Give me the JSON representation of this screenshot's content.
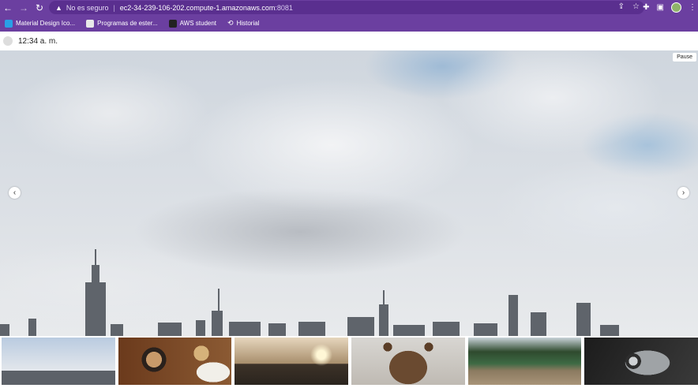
{
  "browser": {
    "security_label": "No es seguro",
    "host": "ec2-34-239-106-202.compute-1.amazonaws.com",
    "port": ":8081",
    "bookmarks": [
      {
        "label": "Material Design Ico..."
      },
      {
        "label": "Programas de ester..."
      },
      {
        "label": "AWS student"
      },
      {
        "label": "Historial"
      }
    ]
  },
  "clock": {
    "time": "12:34 a. m."
  },
  "carousel": {
    "pause_label": "Pause",
    "prev_icon": "chevron-left-icon",
    "next_icon": "chevron-right-icon"
  },
  "thumbnails": [
    {
      "name": "thumbnail-city-skyline"
    },
    {
      "name": "thumbnail-coffee-cup"
    },
    {
      "name": "thumbnail-sunset-valley"
    },
    {
      "name": "thumbnail-bear"
    },
    {
      "name": "thumbnail-lake-dock"
    },
    {
      "name": "thumbnail-camera"
    }
  ]
}
